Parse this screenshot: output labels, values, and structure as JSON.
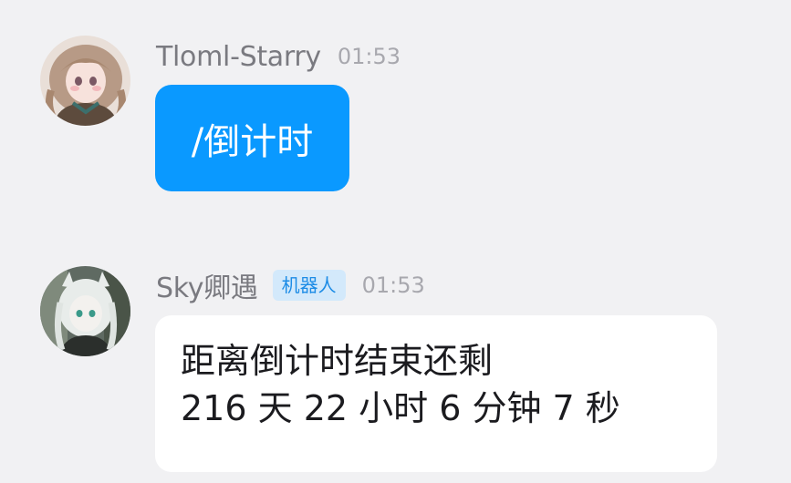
{
  "messages": [
    {
      "sender": "Tloml-Starry",
      "time": "01:53",
      "avatar_icon": "anime-girl-avatar-icon",
      "text": "/倒计时"
    },
    {
      "sender": "Sky卿遇",
      "badge": "机器人",
      "time": "01:53",
      "avatar_icon": "anime-white-hair-avatar-icon",
      "lines": [
        "距离倒计时结束还剩",
        "216 天 22 小时 6 分钟 7 秒"
      ]
    }
  ],
  "colors": {
    "background": "#f1f1f3",
    "bubble_blue": "#0a99ff",
    "bubble_white": "#ffffff",
    "badge_bg": "#d3e9fb",
    "badge_text": "#1d8ce6"
  }
}
